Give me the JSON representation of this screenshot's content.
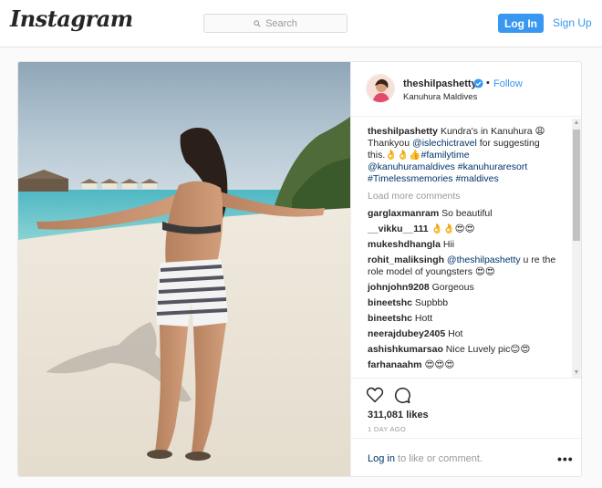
{
  "nav": {
    "logo": "Instagram",
    "search_placeholder": "Search",
    "login_label": "Log In",
    "signup_label": "Sign Up"
  },
  "post": {
    "username": "theshilpashetty",
    "dot": "•",
    "follow_label": "Follow",
    "location": "Kanuhura Maldives",
    "caption": {
      "author": "theshilpashetty",
      "text1": " Kundra's in Kanuhura 😩",
      "text2": "Thankyou ",
      "mention": "@islechictravel",
      "text3": " for suggesting",
      "text4": "this.👌👌👍",
      "tags1": "#familytime",
      "tags2": "@kanuhuramaldives #kanuhuraresort",
      "tags3": "#Timelessmemories #maldives"
    },
    "load_more": "Load more comments",
    "comments": [
      {
        "user": "garglaxmanram",
        "text": " So beautiful"
      },
      {
        "user": "__vikku__111",
        "text": " 👌👌😍😍"
      },
      {
        "user": "mukeshdhangla",
        "text": " Hii"
      },
      {
        "user": "rohit_maliksingh",
        "text_mention": " @theshilpashetty",
        "text": " u re the role model of youngsters 😍😍"
      },
      {
        "user": "johnjohn9208",
        "text": " Gorgeous"
      },
      {
        "user": "bineetshc",
        "text": " Supbbb"
      },
      {
        "user": "bineetshc",
        "text": " Hott"
      },
      {
        "user": "neerajdubey2405",
        "text": " Hot"
      },
      {
        "user": "ashishkumarsao",
        "text": " Nice Luvely pic😊😍"
      },
      {
        "user": "farhanaahm",
        "text": " 😍😍😍"
      }
    ],
    "likes": "311,081 likes",
    "age": "1 DAY AGO",
    "footer_login": "Log in",
    "footer_rest": " to like or comment.",
    "more_label": "•••"
  },
  "colors": {
    "accent": "#3897f0",
    "link": "#003569"
  }
}
